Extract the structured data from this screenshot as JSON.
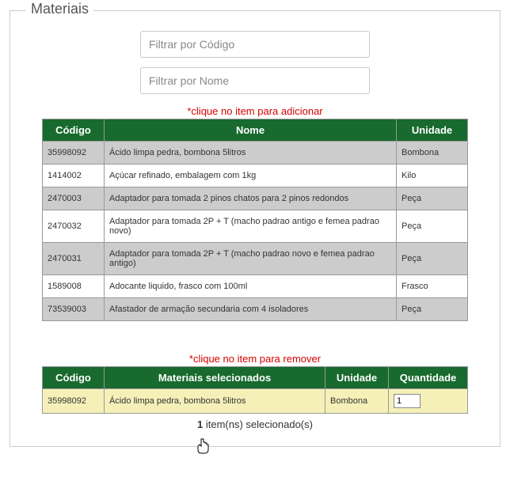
{
  "legend": "Materiais",
  "filters": {
    "codigo": {
      "placeholder": "Filtrar por Código",
      "value": ""
    },
    "nome": {
      "placeholder": "Filtrar por Nome",
      "value": ""
    }
  },
  "hints": {
    "add": "*clique no item para adicionar",
    "remove": "*clique no item para remover"
  },
  "available": {
    "headers": {
      "codigo": "Código",
      "nome": "Nome",
      "unidade": "Unidade"
    },
    "rows": [
      {
        "codigo": "35998092",
        "nome": "Ácido limpa pedra, bombona 5litros",
        "unidade": "Bombona"
      },
      {
        "codigo": "1414002",
        "nome": "Açúcar refinado, embalagem com 1kg",
        "unidade": "Kilo"
      },
      {
        "codigo": "2470003",
        "nome": "Adaptador para tomada 2 pinos chatos para 2 pinos redondos",
        "unidade": "Peça"
      },
      {
        "codigo": "2470032",
        "nome": "Adaptador para tomada 2P + T (macho padrao antigo e femea padrao novo)",
        "unidade": "Peça"
      },
      {
        "codigo": "2470031",
        "nome": "Adaptador para tomada 2P + T (macho padrao novo e femea padrao antigo)",
        "unidade": "Peça"
      },
      {
        "codigo": "1589008",
        "nome": "Adocante liquido, frasco com 100ml",
        "unidade": "Frasco"
      },
      {
        "codigo": "73539003",
        "nome": "Afastador de armação secundaria com 4 isoladores",
        "unidade": "Peça"
      }
    ]
  },
  "selected": {
    "headers": {
      "codigo": "Código",
      "nome": "Materiais selecionados",
      "unidade": "Unidade",
      "qtd": "Quantidade"
    },
    "rows": [
      {
        "codigo": "35998092",
        "nome": "Ácido limpa pedra, bombona 5litros",
        "unidade": "Bombona",
        "qtd": "1"
      }
    ]
  },
  "footer": {
    "count": "1",
    "suffix": " item(ns) selecionado(s)"
  }
}
